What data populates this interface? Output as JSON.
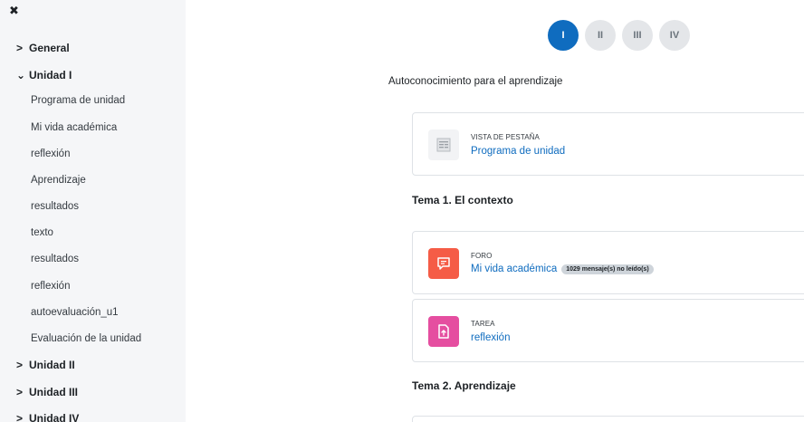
{
  "sidebar": {
    "close_glyph": "✖",
    "general": {
      "chevron": ">",
      "label": "General"
    },
    "unidad1": {
      "chevron": "⌄",
      "label": "Unidad I"
    },
    "items": [
      "Programa de unidad",
      "Mi vida académica",
      "reflexión",
      "Aprendizaje",
      "resultados",
      "texto",
      "resultados",
      "reflexión",
      "autoevaluación_u1",
      "Evaluación de la unidad"
    ],
    "unidad2": {
      "chevron": ">",
      "label": "Unidad II"
    },
    "unidad3": {
      "chevron": ">",
      "label": "Unidad III"
    },
    "unidad4": {
      "chevron": ">",
      "label": "Unidad IV"
    }
  },
  "pager": [
    "I",
    "II",
    "III",
    "IV"
  ],
  "intro": "Autoconocimiento para el aprendizaje",
  "activities": [
    {
      "type": "VISTA DE PESTAÑA",
      "name": "Programa de unidad",
      "icon": "page-icon"
    },
    {
      "type": "FORO",
      "name": "Mi vida académica",
      "badge": "1029 mensaje(s) no leído(s)",
      "icon": "forum-icon",
      "color": "#f55c46"
    },
    {
      "type": "TAREA",
      "name": "reflexión",
      "icon": "assignment-icon",
      "color": "#e54ea0"
    }
  ],
  "topics": [
    "Tema 1. El contexto",
    "Tema 2. Aprendizaje"
  ],
  "colors": {
    "primary": "#0f6cbf",
    "sidebar_bg": "#f5f6f8"
  }
}
